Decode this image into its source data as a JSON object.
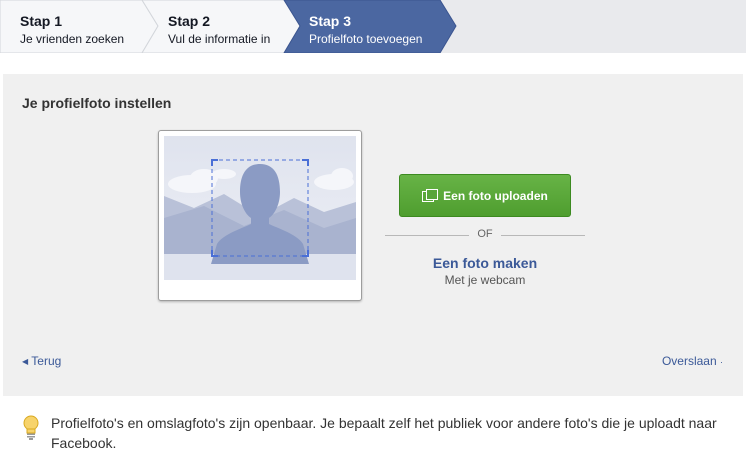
{
  "steps": [
    {
      "number": "Stap 1",
      "description": "Je vrienden zoeken",
      "active": false
    },
    {
      "number": "Stap 2",
      "description": "Vul de informatie in",
      "active": false
    },
    {
      "number": "Stap 3",
      "description": "Profielfoto toevoegen",
      "active": true
    }
  ],
  "panel": {
    "title": "Je profielfoto instellen",
    "upload_label": "Een foto uploaden",
    "or_label": "OF",
    "webcam_label": "Een foto maken",
    "webcam_sub": "Met je webcam",
    "back_label": "Terug",
    "skip_label": "Overslaan"
  },
  "notice": {
    "text": "Profielfoto's en omslagfoto's zijn openbaar. Je bepaalt zelf het publiek voor andere foto's die je uploadt naar Facebook."
  },
  "colors": {
    "link": "#3b5998",
    "active_step": "#4b67a1",
    "upload_button": "#5aa839"
  },
  "icons": [
    "upload-photos-icon",
    "left-arrow-icon",
    "right-arrow-icon",
    "lightbulb-icon"
  ]
}
